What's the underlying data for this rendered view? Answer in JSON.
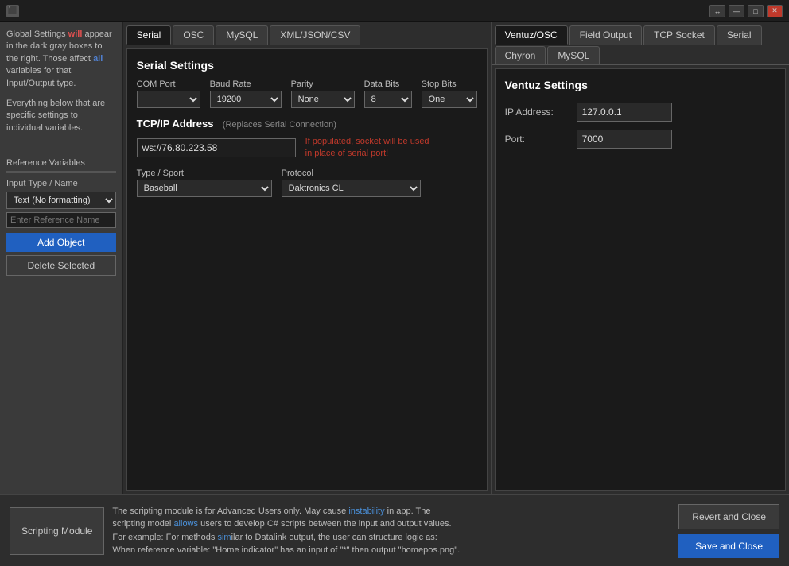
{
  "titlebar": {
    "icon": "⬛",
    "controls": {
      "resize": "↔",
      "minimize": "—",
      "maximize": "□",
      "close": "✕"
    }
  },
  "sidebar": {
    "global_text_line1": "Global Settings ",
    "global_text_bold": "will",
    "global_text_line2": " appear in the dark gray boxes to the right. Those affect ",
    "global_text_all": "all",
    "global_text_line3": " variables for that Input/Output type.",
    "below_text": "Everything below that are specific settings to individual variables.",
    "ref_variables_label": "Reference Variables",
    "input_type_label": "Input Type / Name",
    "input_type_value": "Text (No formatting)",
    "ref_name_placeholder": "Enter Reference Name",
    "add_object_label": "Add Object",
    "delete_selected_label": "Delete Selected"
  },
  "center_tabs": [
    {
      "label": "Serial",
      "active": true
    },
    {
      "label": "OSC",
      "active": false
    },
    {
      "label": "MySQL",
      "active": false
    },
    {
      "label": "XML/JSON/CSV",
      "active": false
    }
  ],
  "serial_settings": {
    "title": "Serial Settings",
    "com_port_label": "COM Port",
    "com_port_value": "",
    "baud_rate_label": "Baud Rate",
    "baud_rate_value": "19200",
    "parity_label": "Parity",
    "parity_value": "None",
    "data_bits_label": "Data Bits",
    "data_bits_value": "8",
    "stop_bits_label": "Stop Bits",
    "stop_bits_value": "One",
    "tcp_title": "TCP/IP Address",
    "tcp_subtitle": "(Replaces Serial Connection)",
    "tcp_value": "ws://76.80.223.58",
    "tcp_notice": "If populated, socket will be used\nin place of serial port!",
    "sport_label": "Type / Sport",
    "sport_value": "Baseball",
    "protocol_label": "Protocol",
    "protocol_value": "Daktronics CL"
  },
  "right_tabs": [
    {
      "label": "Ventuz/OSC",
      "active": true
    },
    {
      "label": "Field Output",
      "active": false
    },
    {
      "label": "TCP Socket",
      "active": false
    },
    {
      "label": "Serial",
      "active": false
    },
    {
      "label": "Chyron",
      "active": false
    },
    {
      "label": "MySQL",
      "active": false
    }
  ],
  "ventuz_settings": {
    "title": "Ventuz Settings",
    "ip_label": "IP Address:",
    "ip_value": "127.0.0.1",
    "port_label": "Port:",
    "port_value": "7000"
  },
  "bottom": {
    "scripting_module_label": "Scripting Module",
    "description_line1": "The scripting module is for Advanced Users only. May cause instability in app. The",
    "description_line2": "scripting model allows users to develop C# scripts between the input and output values.",
    "description_line3": "For example: For methods similar to Datalink output, the user can structure logic as:",
    "description_line4": "When reference variable: \"Home indicator\" has an input of \"*\" then output \"homepos.png\".",
    "revert_label": "Revert and Close",
    "save_label": "Save and Close"
  }
}
